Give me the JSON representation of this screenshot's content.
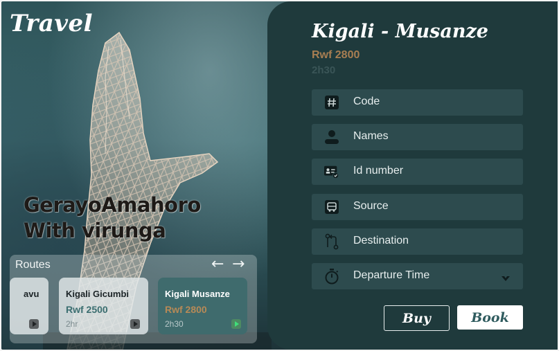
{
  "brand": "Travel",
  "hero": {
    "headline_line1": "GerayoAmahoro",
    "headline_line2": "With virunga"
  },
  "routes": {
    "title": "Routes",
    "prev_arrow": "←",
    "next_arrow": "→",
    "cards": [
      {
        "title": "avu",
        "price": "",
        "time": "",
        "icon": "play-icon"
      },
      {
        "title": "Kigali  Gicumbi",
        "price": "Rwf 2500",
        "time": "2hr",
        "icon": "play-icon"
      },
      {
        "title": "Kigali  Musanze",
        "price": "Rwf 2800",
        "time": "2h30",
        "icon": "play-icon"
      }
    ]
  },
  "booking": {
    "title": "Kigali - Musanze",
    "price": "Rwf 2800",
    "duration": "2h30",
    "fields": [
      {
        "label": "Code",
        "icon": "hash-icon"
      },
      {
        "label": "Names",
        "icon": "person-icon"
      },
      {
        "label": "Id number",
        "icon": "id-card-icon"
      },
      {
        "label": "Source",
        "icon": "bus-icon"
      },
      {
        "label": "Destination",
        "icon": "route-icon"
      },
      {
        "label": "Departure Time",
        "icon": "stopwatch-icon"
      }
    ],
    "buy_label": "Buy",
    "book_label": "Book"
  },
  "colors": {
    "panel": "#1f3a3c",
    "field": "#2d4b4e",
    "accent_price": "#a87e52",
    "card_selected": "#3f6b6d"
  }
}
